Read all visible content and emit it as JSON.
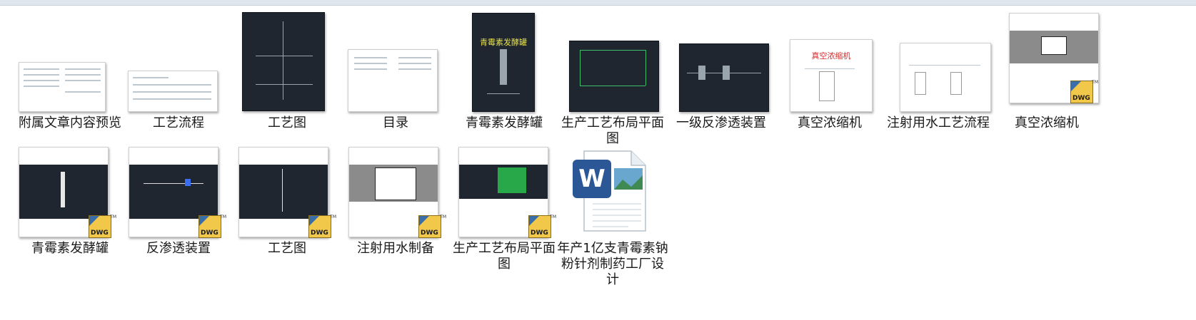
{
  "files": [
    {
      "name": "附属文章内容预览",
      "type": "image"
    },
    {
      "name": "工艺流程",
      "type": "image"
    },
    {
      "name": "工艺图",
      "type": "image"
    },
    {
      "name": "目录",
      "type": "image"
    },
    {
      "name": "青霉素发酵罐",
      "type": "image",
      "thumb_title": "青霉素发酵罐"
    },
    {
      "name": "生产工艺布局平面图",
      "type": "image"
    },
    {
      "name": "一级反渗透装置",
      "type": "image"
    },
    {
      "name": "真空浓缩机",
      "type": "image",
      "thumb_title": "真空浓缩机"
    },
    {
      "name": "注射用水工艺流程",
      "type": "image"
    },
    {
      "name": "真空浓缩机",
      "type": "dwg"
    },
    {
      "name": "青霉素发酵罐",
      "type": "dwg"
    },
    {
      "name": "反渗透装置",
      "type": "dwg"
    },
    {
      "name": "工艺图",
      "type": "dwg"
    },
    {
      "name": "注射用水制备",
      "type": "dwg"
    },
    {
      "name": "生产工艺布局平面图",
      "type": "dwg"
    },
    {
      "name": "年产1亿支青霉素钠粉针剂制药工厂设计",
      "type": "doc"
    }
  ],
  "dwg_badge": "DWG",
  "colors": {
    "cad_bg": "#1f2630",
    "dwg_badge": "#f2c84b",
    "word_blue": "#2b5797"
  }
}
